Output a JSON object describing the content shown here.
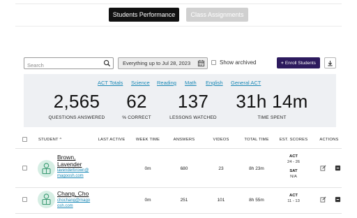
{
  "tabs": {
    "students_performance": "Students Performance",
    "class_assignments": "Class Assignments"
  },
  "toolbar": {
    "search_placeholder": "Search",
    "date_range": "Everything up to Jul 28, 2023",
    "show_archived": "Show archived",
    "enroll_label": "Enroll Students",
    "enroll_icon": "plus-icon",
    "download_icon": "download-icon"
  },
  "filters": [
    "ACT Totals",
    "Science",
    "Reading",
    "Math",
    "English",
    "General ACT"
  ],
  "stats": [
    {
      "value": "2,565",
      "label": "QUESTIONS ANSWERED"
    },
    {
      "value": "62",
      "label": "% CORRECT"
    },
    {
      "value": "137",
      "label": "LESSONS WATCHED"
    },
    {
      "value": "31h 14m",
      "label": "TIME SPENT"
    }
  ],
  "table": {
    "headers": {
      "student": "STUDENT",
      "last_active": "LAST ACTIVE",
      "week_time": "WEEK TIME",
      "answers": "ANSWERS",
      "videos": "VIDEOS",
      "total_time": "TOTAL TIME",
      "est_scores": "EST. SCORES",
      "actions": "ACTIONS"
    },
    "sort_indicator": "^",
    "rows": [
      {
        "name": "Brown, Lavender",
        "email": "lavenderbrown@magoosh.com",
        "last_active": "",
        "week_time": "0m",
        "answers": "680",
        "videos": "23",
        "total_time": "8h 23m",
        "act_label": "ACT",
        "act_score": "24 - 26",
        "sat_label": "SAT",
        "sat_score": "N/A"
      },
      {
        "name": "Chang, Cho",
        "email": "chochang@magoosh.com",
        "last_active": "",
        "week_time": "0m",
        "answers": "251",
        "videos": "101",
        "total_time": "8h 55m",
        "act_label": "ACT",
        "act_score": "11 - 13"
      }
    ]
  },
  "colors": {
    "active_tab": "#111111",
    "inactive_tab": "#d0d0d0",
    "enroll_button": "#2d1b5e",
    "link": "#1b89b6",
    "stats_bg": "#eef0f3",
    "avatar_bg": "#d6eee4"
  }
}
